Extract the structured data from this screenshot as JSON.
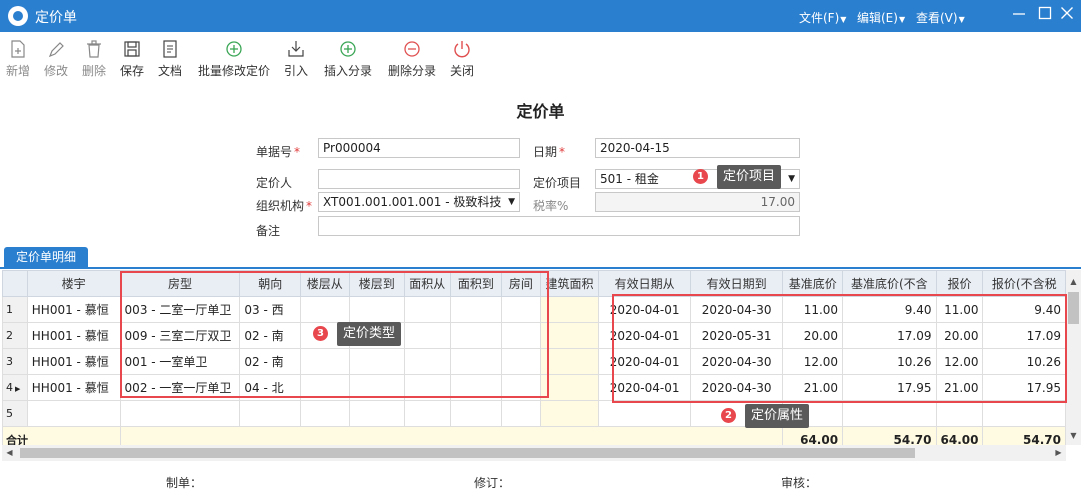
{
  "window": {
    "title": "定价单",
    "menus": [
      "文件(F)",
      "编辑(E)",
      "查看(V)"
    ]
  },
  "toolbar": {
    "items": [
      {
        "label": "新增",
        "icon": "new-document-icon"
      },
      {
        "label": "修改",
        "icon": "edit-icon"
      },
      {
        "label": "删除",
        "icon": "trash-icon"
      },
      {
        "label": "保存",
        "icon": "save-icon"
      },
      {
        "label": "文档",
        "icon": "document-icon"
      },
      {
        "label": "批量修改定价",
        "icon": "plus-circle-icon"
      },
      {
        "label": "引入",
        "icon": "import-icon"
      },
      {
        "label": "插入分录",
        "icon": "plus-circle-icon"
      },
      {
        "label": "删除分录",
        "icon": "minus-circle-icon"
      },
      {
        "label": "关闭",
        "icon": "power-icon"
      }
    ]
  },
  "form": {
    "title": "定价单",
    "bill_no_label": "单据号",
    "bill_no": "Pr000004",
    "date_label": "日期",
    "date": "2020-04-15",
    "pricer_label": "定价人",
    "pricer": "",
    "item_label": "定价项目",
    "item": "501 - 租金",
    "org_label": "组织机构",
    "org": "XT001.001.001.001 - 极致科技",
    "tax_label": "税率%",
    "tax": "17.00",
    "remark_label": "备注",
    "remark": ""
  },
  "tab": {
    "label": "定价单明细"
  },
  "grid": {
    "columns": [
      "楼宇",
      "房型",
      "朝向",
      "楼层从",
      "楼层到",
      "面积从",
      "面积到",
      "房间",
      "建筑面积",
      "有效日期从",
      "有效日期到",
      "基准底价",
      "基准底价(不含",
      "报价",
      "报价(不含税"
    ],
    "rows": [
      {
        "no": "1",
        "building": "HH001 - 慕恒",
        "room_type": "003 - 二室一厅单卫",
        "facing": "03 - 西",
        "from": "2020-04-01",
        "to": "2020-04-30",
        "base": "11.00",
        "base_ex": "9.40",
        "quote": "11.00",
        "quote_ex": "9.40"
      },
      {
        "no": "2",
        "building": "HH001 - 慕恒",
        "room_type": "009 - 三室二厅双卫",
        "facing": "02 - 南",
        "from": "2020-04-01",
        "to": "2020-05-31",
        "base": "20.00",
        "base_ex": "17.09",
        "quote": "20.00",
        "quote_ex": "17.09"
      },
      {
        "no": "3",
        "building": "HH001 - 慕恒",
        "room_type": "001 - 一室单卫",
        "facing": "02 - 南",
        "from": "2020-04-01",
        "to": "2020-04-30",
        "base": "12.00",
        "base_ex": "10.26",
        "quote": "12.00",
        "quote_ex": "10.26"
      },
      {
        "no": "4",
        "building": "HH001 - 慕恒",
        "room_type": "002 - 一室一厅单卫",
        "facing": "04 - 北",
        "from": "2020-04-01",
        "to": "2020-04-30",
        "base": "21.00",
        "base_ex": "17.95",
        "quote": "21.00",
        "quote_ex": "17.95"
      },
      {
        "no": "5",
        "building": "",
        "room_type": "",
        "facing": "",
        "from": "",
        "to": "",
        "base": "",
        "base_ex": "",
        "quote": "",
        "quote_ex": ""
      }
    ],
    "total": {
      "label": "合计",
      "base": "64.00",
      "base_ex": "54.70",
      "quote": "64.00",
      "quote_ex": "54.70"
    }
  },
  "annotations": [
    {
      "number": "1",
      "text": "定价项目"
    },
    {
      "number": "2",
      "text": "定价属性"
    },
    {
      "number": "3",
      "text": "定价类型"
    }
  ],
  "footer": {
    "maker": "制单：",
    "reviser": "修订：",
    "auditor": "审核："
  },
  "colors": {
    "accent": "#2b7fcf",
    "annotation": "#e8484d",
    "highlight": "#fffbe3"
  }
}
